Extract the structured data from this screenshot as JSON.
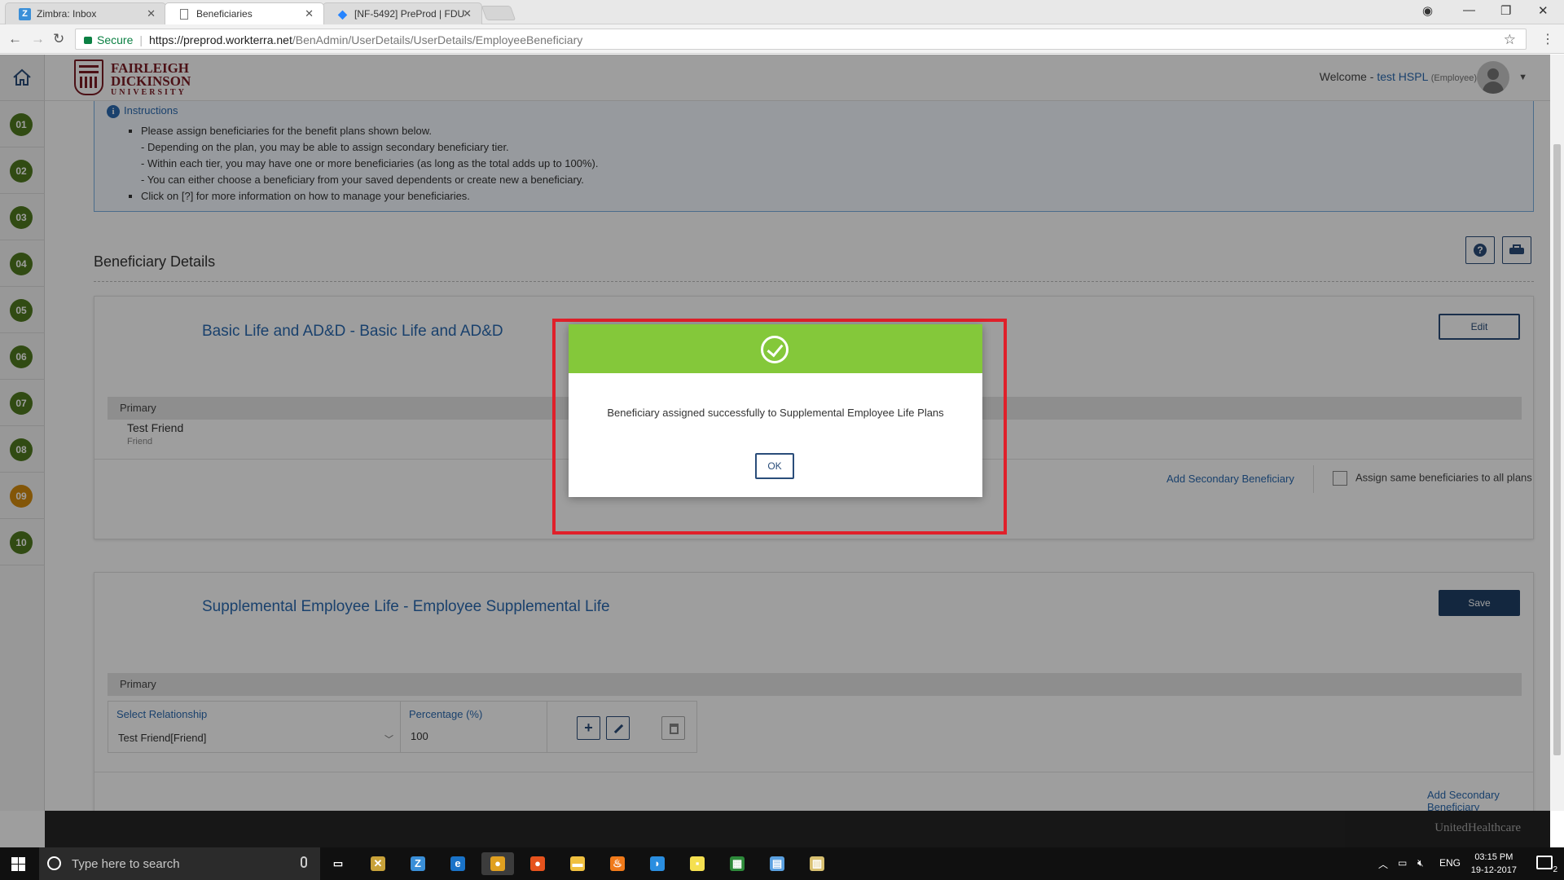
{
  "browser": {
    "tabs": [
      {
        "label": "Zimbra: Inbox",
        "favicon": "Z",
        "favicon_color": "#3a8fd8",
        "active": false
      },
      {
        "label": "Beneficiaries",
        "favicon": "",
        "favicon_color": "#666666",
        "active": true
      },
      {
        "label": "[NF-5492] PreProd | FDU",
        "favicon": "◆",
        "favicon_color": "#2684ff",
        "active": false
      }
    ],
    "secure_label": "Secure",
    "url_host": "https://preprod.workterra.net",
    "url_path": "/BenAdmin/UserDetails/UserDetails/EmployeeBeneficiary"
  },
  "header": {
    "logo_line1": "FAIRLEIGH",
    "logo_line2": "DICKINSON",
    "logo_line3": "UNIVERSITY",
    "welcome_label": "Welcome -",
    "user_name": "test HSPL",
    "user_role": "(Employee)"
  },
  "sidebar": {
    "steps": [
      {
        "label": "01",
        "color": "#4f7a1f"
      },
      {
        "label": "02",
        "color": "#4f7a1f"
      },
      {
        "label": "03",
        "color": "#4f7a1f"
      },
      {
        "label": "04",
        "color": "#4f7a1f"
      },
      {
        "label": "05",
        "color": "#4f7a1f"
      },
      {
        "label": "06",
        "color": "#4f7a1f"
      },
      {
        "label": "07",
        "color": "#4f7a1f"
      },
      {
        "label": "08",
        "color": "#4f7a1f"
      },
      {
        "label": "09",
        "color": "#d48b0d"
      },
      {
        "label": "10",
        "color": "#4f7a1f"
      }
    ]
  },
  "instructions": {
    "title": "Instructions",
    "item1": "Please assign beneficiaries for the benefit plans shown below.",
    "sub1": "- Depending on the plan, you may be able to assign secondary beneficiary tier.",
    "sub2": "- Within each tier, you may have one or more beneficiaries (as long as the total adds up to 100%).",
    "sub3": "- You can either choose a beneficiary from your saved dependents or create new a beneficiary.",
    "item2": "Click on [?] for more information on how to manage your beneficiaries."
  },
  "section": {
    "title": "Beneficiary Details"
  },
  "plans": [
    {
      "name": "Basic Life and AD&D - Basic Life and AD&D",
      "action_label": "Edit",
      "tier_label": "Primary",
      "beneficiary_name": "Test Friend",
      "beneficiary_relation": "Friend",
      "add_secondary_label": "Add Secondary Beneficiary",
      "assign_same_label": "Assign same beneficiaries to all plans"
    },
    {
      "name": "Supplemental Employee Life - Employee Supplemental Life",
      "action_label": "Save",
      "tier_label": "Primary",
      "relationship_label": "Select Relationship",
      "relationship_value": "Test Friend[Friend]",
      "percentage_label": "Percentage (%)",
      "percentage_value": "100",
      "add_secondary_label": "Add Secondary Beneficiary"
    }
  ],
  "modal": {
    "message": "Beneficiary assigned successfully to Supplemental Employee Life Plans",
    "ok_label": "OK",
    "header_color": "#84c83a"
  },
  "footer": {
    "brand": "UnitedHealthcare"
  },
  "taskbar": {
    "search_placeholder": "Type here to search",
    "language": "ENG",
    "time": "03:15 PM",
    "date": "19-12-2017",
    "notification_count": "2",
    "apps": [
      {
        "name": "task-view-icon",
        "glyph": "▭",
        "color": "#101010"
      },
      {
        "name": "tools-app-icon",
        "glyph": "✕",
        "color": "#c8a23a"
      },
      {
        "name": "zimbra-app-icon",
        "glyph": "Z",
        "color": "#3a8fd8"
      },
      {
        "name": "edge-app-icon",
        "glyph": "e",
        "color": "#1a73c8"
      },
      {
        "name": "chrome-app-icon",
        "glyph": "●",
        "color": "#e0a020"
      },
      {
        "name": "firefox-app-icon",
        "glyph": "●",
        "color": "#e6531d"
      },
      {
        "name": "file-explorer-app-icon",
        "glyph": "▬",
        "color": "#f0c040"
      },
      {
        "name": "flame-app-icon",
        "glyph": "♨",
        "color": "#f07a1a"
      },
      {
        "name": "messenger-app-icon",
        "glyph": "◗",
        "color": "#2a8ee0"
      },
      {
        "name": "sticky-notes-app-icon",
        "glyph": "▪",
        "color": "#f5e050"
      },
      {
        "name": "spreadsheet-app-icon",
        "glyph": "▦",
        "color": "#2d8a3a"
      },
      {
        "name": "document-app-icon",
        "glyph": "▤",
        "color": "#5aa0e0"
      },
      {
        "name": "archive-app-icon",
        "glyph": "▥",
        "color": "#d8c070"
      }
    ]
  }
}
